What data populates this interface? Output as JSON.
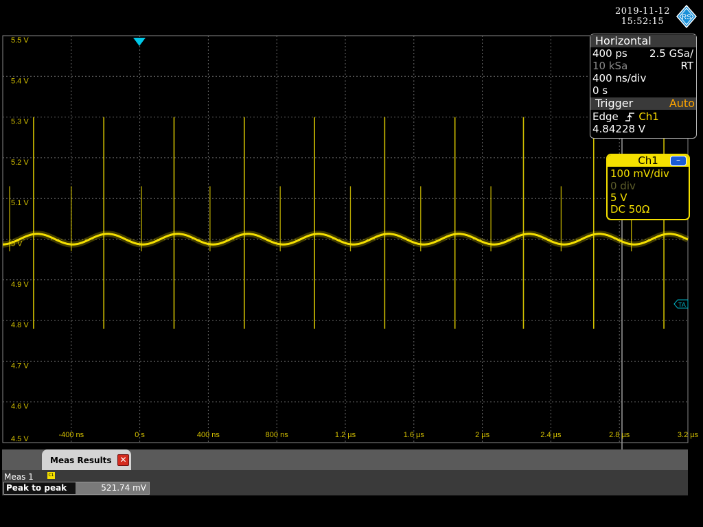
{
  "header": {
    "date": "2019-11-12",
    "time": "15:52:15",
    "logo_text": "RS"
  },
  "colors": {
    "trace": "#f5e000",
    "grid": "#6a6a6a",
    "axis_label": "#d4c000",
    "trigger_marker": "#00c8e8",
    "ref_marker": "#00b4c8"
  },
  "screen": {
    "y_labels": [
      "5.5 V",
      "5.4 V",
      "5.3 V",
      "5.2 V",
      "5.1 V",
      "5 V",
      "4.9 V",
      "4.8 V",
      "4.7 V",
      "4.6 V",
      "4.5 V"
    ],
    "x_labels": [
      "-400 ns",
      "0 s",
      "400 ns",
      "800 ns",
      "1.2 µs",
      "1.6 µs",
      "2 µs",
      "2.4 µs",
      "2.8 µs",
      "3.2 µs"
    ],
    "trigger_marker_icon": "trigger-position-triangle",
    "ref_marker_label": "TA"
  },
  "horizontal": {
    "title": "Horizontal",
    "resolution": "400 ps",
    "sample_rate": "2.5 GSa/",
    "record_length": "10 kSa",
    "mode": "RT",
    "time_scale": "400 ns/div",
    "position": "0 s"
  },
  "trigger": {
    "title": "Trigger",
    "mode": "Auto",
    "type": "Edge",
    "slope_icon": "rising-edge-icon",
    "source": "Ch1",
    "level": "4.84228 V"
  },
  "ch1": {
    "title": "Ch1",
    "minimize_label": "–",
    "scale": "100 mV/div",
    "offset": "0 div",
    "position": "5 V",
    "coupling": "DC 50Ω"
  },
  "meas": {
    "tab_label": "Meas Results",
    "close_icon": "close-icon",
    "name": "Meas 1",
    "source_badge": "C1",
    "parameter": "Peak to peak",
    "value": "521.74 mV"
  },
  "chart_data": {
    "type": "line",
    "title": "",
    "xlabel": "",
    "ylabel": "",
    "xunit": "s",
    "yunit": "V",
    "xlim": [
      -6e-07,
      3.4e-06
    ],
    "ylim": [
      4.5,
      5.5
    ],
    "grid": true,
    "series": [
      {
        "ripple_mean": 5.0,
        "ripple_amplitude": 0.013,
        "ripple_period": 4.1e-07,
        "spike_times": [
          -4.2e-07,
          -1e-08,
          4e-07,
          8.1e-07,
          1.22e-06,
          1.63e-06,
          2.04e-06,
          2.44e-06,
          2.85e-06,
          3.26e-06
        ],
        "spike_high": 5.3,
        "spike_low": 4.78,
        "minor_spike_times": [
          -5.6e-07,
          -2e-07,
          2.1e-07,
          6.1e-07,
          1.02e-06,
          1.43e-06,
          1.84e-06,
          2.25e-06,
          2.66e-06,
          3.07e-06
        ],
        "minor_spike_high": 5.13,
        "minor_spike_low": 4.97
      }
    ]
  }
}
